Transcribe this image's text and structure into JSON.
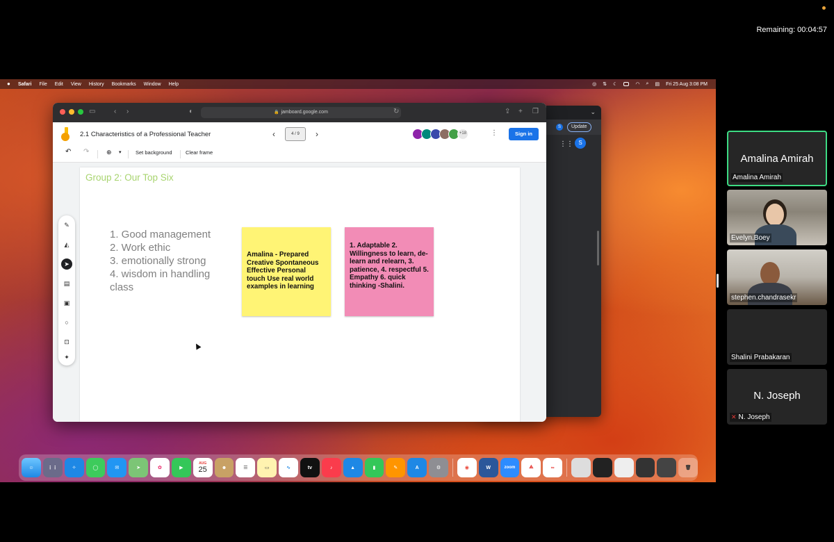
{
  "zoom": {
    "remaining_label": "Remaining: 00:04:57",
    "participants": [
      {
        "name": "Amalina Amirah",
        "big_name": "Amalina Amirah",
        "active": true
      },
      {
        "name": "Evelyn.Boey",
        "video": true
      },
      {
        "name": "stephen.chandrasekr",
        "video": true
      },
      {
        "name": "Shalini Prabakaran"
      },
      {
        "name": "N. Joseph",
        "big_name": "N. Joseph",
        "muted": true
      }
    ]
  },
  "macos": {
    "menubar": [
      "Safari",
      "File",
      "Edit",
      "View",
      "History",
      "Bookmarks",
      "Window",
      "Help"
    ],
    "clock": "Fri 25 Aug  3:08 PM"
  },
  "chrome_bg": {
    "profile_initial": "S",
    "update_label": "Update"
  },
  "safari": {
    "url": "jamboard.google.com"
  },
  "jamboard": {
    "title": "2.1 Characteristics of a Professional Teacher",
    "frame_indicator": "4 / 9",
    "more_collaborators": "+18",
    "signin_label": "Sign in",
    "toolbar": {
      "set_background": "Set background",
      "clear_frame": "Clear frame"
    },
    "frame_title": "Group 2: Our Top Six",
    "list": [
      "1. Good management",
      "2. Work ethic",
      "3. emotionally strong",
      "4. wisdom in handling class"
    ],
    "sticky_yellow": "Amalina - Prepared Creative Spontaneous Effective Personal touch Use real world examples in learning",
    "sticky_pink": "1. Adaptable 2. Willingness to learn, de-learn and relearn, 3. patience, 4. respectful 5. Empathy 6. quick thinking -Shalini."
  },
  "dock": {
    "calendar_month": "AUG",
    "calendar_day": "25",
    "tv_label": "tv",
    "zoom_label": "zoom"
  },
  "colors": {
    "frame_title": "#a8d46f",
    "sticky_yellow": "#fff475",
    "sticky_pink": "#f28cb6",
    "signin": "#1a73e8",
    "active_speaker": "#3ddc84"
  }
}
